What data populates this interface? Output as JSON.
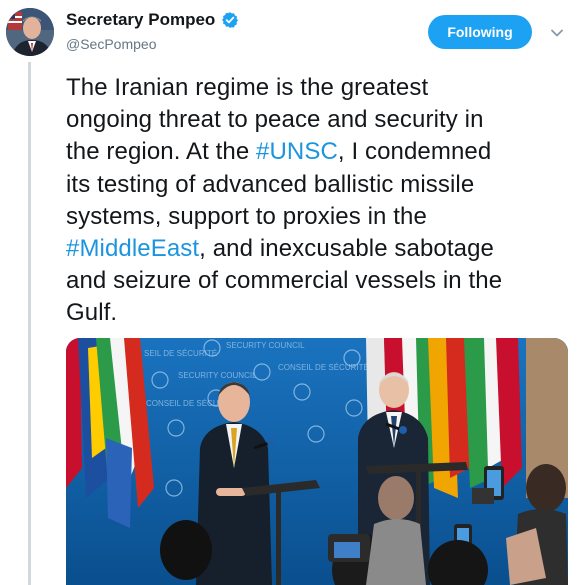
{
  "author": {
    "name": "Secretary Pompeo",
    "handle": "@SecPompeo",
    "verified": true
  },
  "follow_button": {
    "label": "Following"
  },
  "tweet": {
    "lines": [
      [
        {
          "t": "The Iranian regime is the greatest"
        }
      ],
      [
        {
          "t": "ongoing threat to peace and security in"
        }
      ],
      [
        {
          "t": "the region. At the "
        },
        {
          "t": "#UNSC",
          "h": true
        },
        {
          "t": ", I condemned"
        }
      ],
      [
        {
          "t": "its testing of advanced ballistic missile"
        }
      ],
      [
        {
          "t": "systems, support to proxies in the"
        }
      ],
      [
        {
          "t": ""
        },
        {
          "t": "#MiddleEast",
          "h": true
        },
        {
          "t": ", and inexcusable sabotage"
        }
      ],
      [
        {
          "t": "and seizure of commercial vessels in the"
        }
      ],
      [
        {
          "t": "Gulf."
        }
      ]
    ]
  },
  "photo": {
    "backdrop_text": [
      "SEIL DE SÉCURITÉ",
      "SECURITY COUNCIL",
      "CONSEIL DE SÉCURITÉ",
      "SECURITY COUNCIL",
      "CONSEIL DE SÉCURITÉ"
    ]
  },
  "colors": {
    "accent": "#1da1f2",
    "hashtag": "#1b95e0",
    "text": "#14171a",
    "muted": "#657786",
    "un_backdrop": "#0c5fa6"
  },
  "icons": [
    "verified-badge-icon",
    "chevron-down-icon"
  ]
}
